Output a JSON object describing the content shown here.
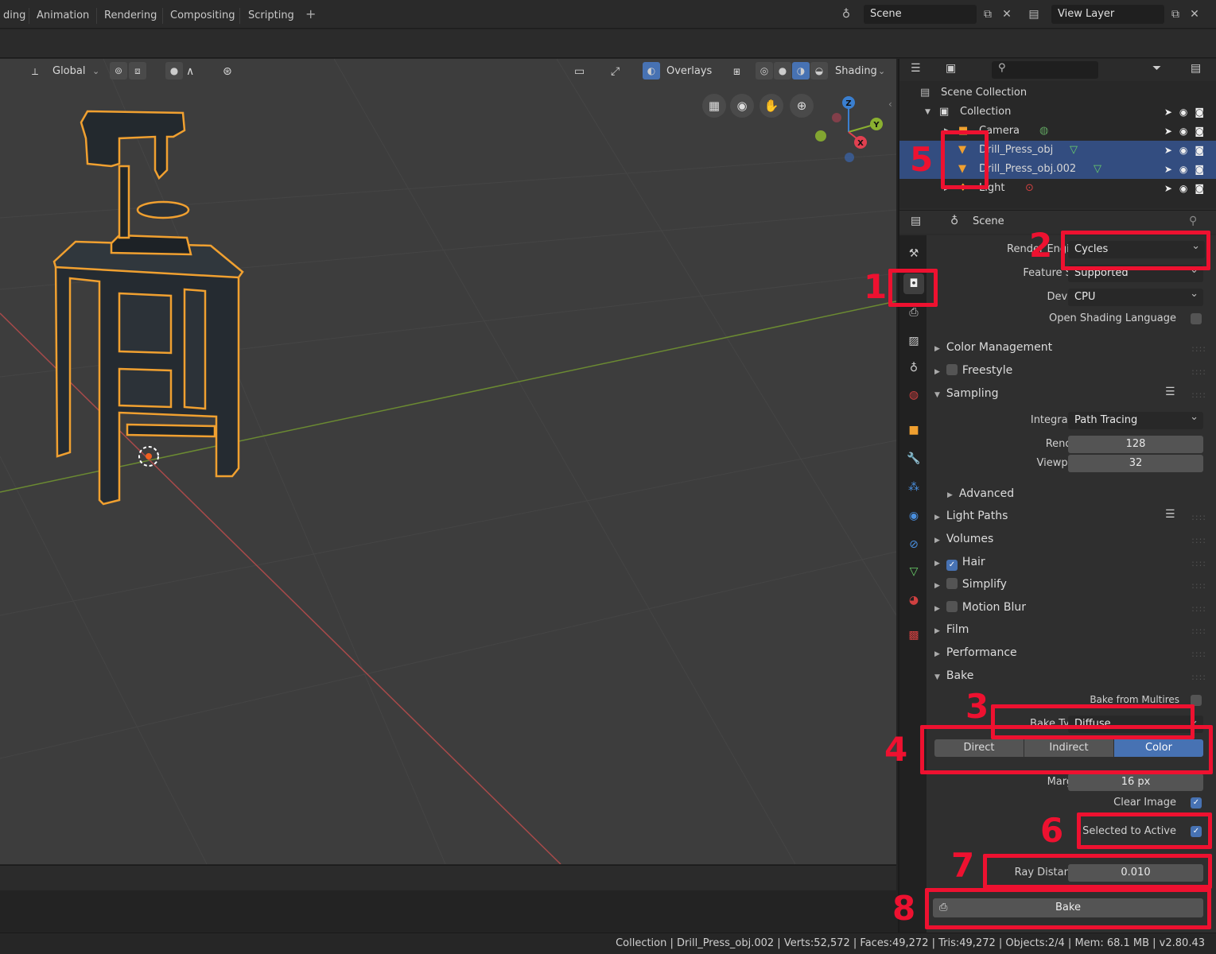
{
  "workspace_tabs": [
    "ding",
    "Animation",
    "Rendering",
    "Compositing",
    "Scripting"
  ],
  "top": {
    "scene_label": "Scene",
    "view_layer_label": "View Layer"
  },
  "viewport": {
    "orientation": "Global",
    "overlays": "Overlays",
    "shading": "Shading",
    "gizmo_axes": {
      "x": "X",
      "y": "Y",
      "z": "Z"
    }
  },
  "outliner": {
    "rows": [
      {
        "label": "Scene Collection"
      },
      {
        "label": "Collection"
      },
      {
        "label": "Camera"
      },
      {
        "label": "Drill_Press_obj"
      },
      {
        "label": "Drill_Press_obj.002"
      },
      {
        "label": "Light"
      }
    ]
  },
  "properties": {
    "header": "Scene",
    "render_engine_label": "Render Engine",
    "render_engine": "Cycles",
    "feature_set_label": "Feature Set",
    "feature_set": "Supported",
    "device_label": "Device",
    "device": "CPU",
    "osl_label": "Open Shading Language",
    "sections": {
      "color_management": "Color Management",
      "freestyle": "Freestyle",
      "sampling": "Sampling",
      "advanced": "Advanced",
      "light_paths": "Light Paths",
      "volumes": "Volumes",
      "hair": "Hair",
      "simplify": "Simplify",
      "motion_blur": "Motion Blur",
      "film": "Film",
      "performance": "Performance",
      "bake": "Bake"
    },
    "integrator_label": "Integrator",
    "integrator": "Path Tracing",
    "render_label": "Render",
    "render_samples": "128",
    "viewport_label": "Viewport",
    "viewport_samples": "32",
    "bake_from_multires": "Bake from Multires",
    "bake_type_label": "Bake Type",
    "bake_type": "Diffuse",
    "contrib": [
      "Direct",
      "Indirect",
      "Color"
    ],
    "margin_label": "Margin",
    "margin": "16 px",
    "clear_image": "Clear Image",
    "selected_to_active": "Selected to Active",
    "ray_distance_label": "Ray Distance",
    "ray_distance": "0.010",
    "bake_button": "Bake"
  },
  "status": "Collection | Drill_Press_obj.002 | Verts:52,572 | Faces:49,272 | Tris:49,272 | Objects:2/4 | Mem: 68.1 MB | v2.80.43",
  "annotations": [
    "1",
    "2",
    "3",
    "4",
    "5",
    "6",
    "7",
    "8"
  ],
  "colors": {
    "accent": "#4772b3",
    "selection": "#334d80",
    "annotation": "#ee1130",
    "outline": "#f0a030"
  }
}
